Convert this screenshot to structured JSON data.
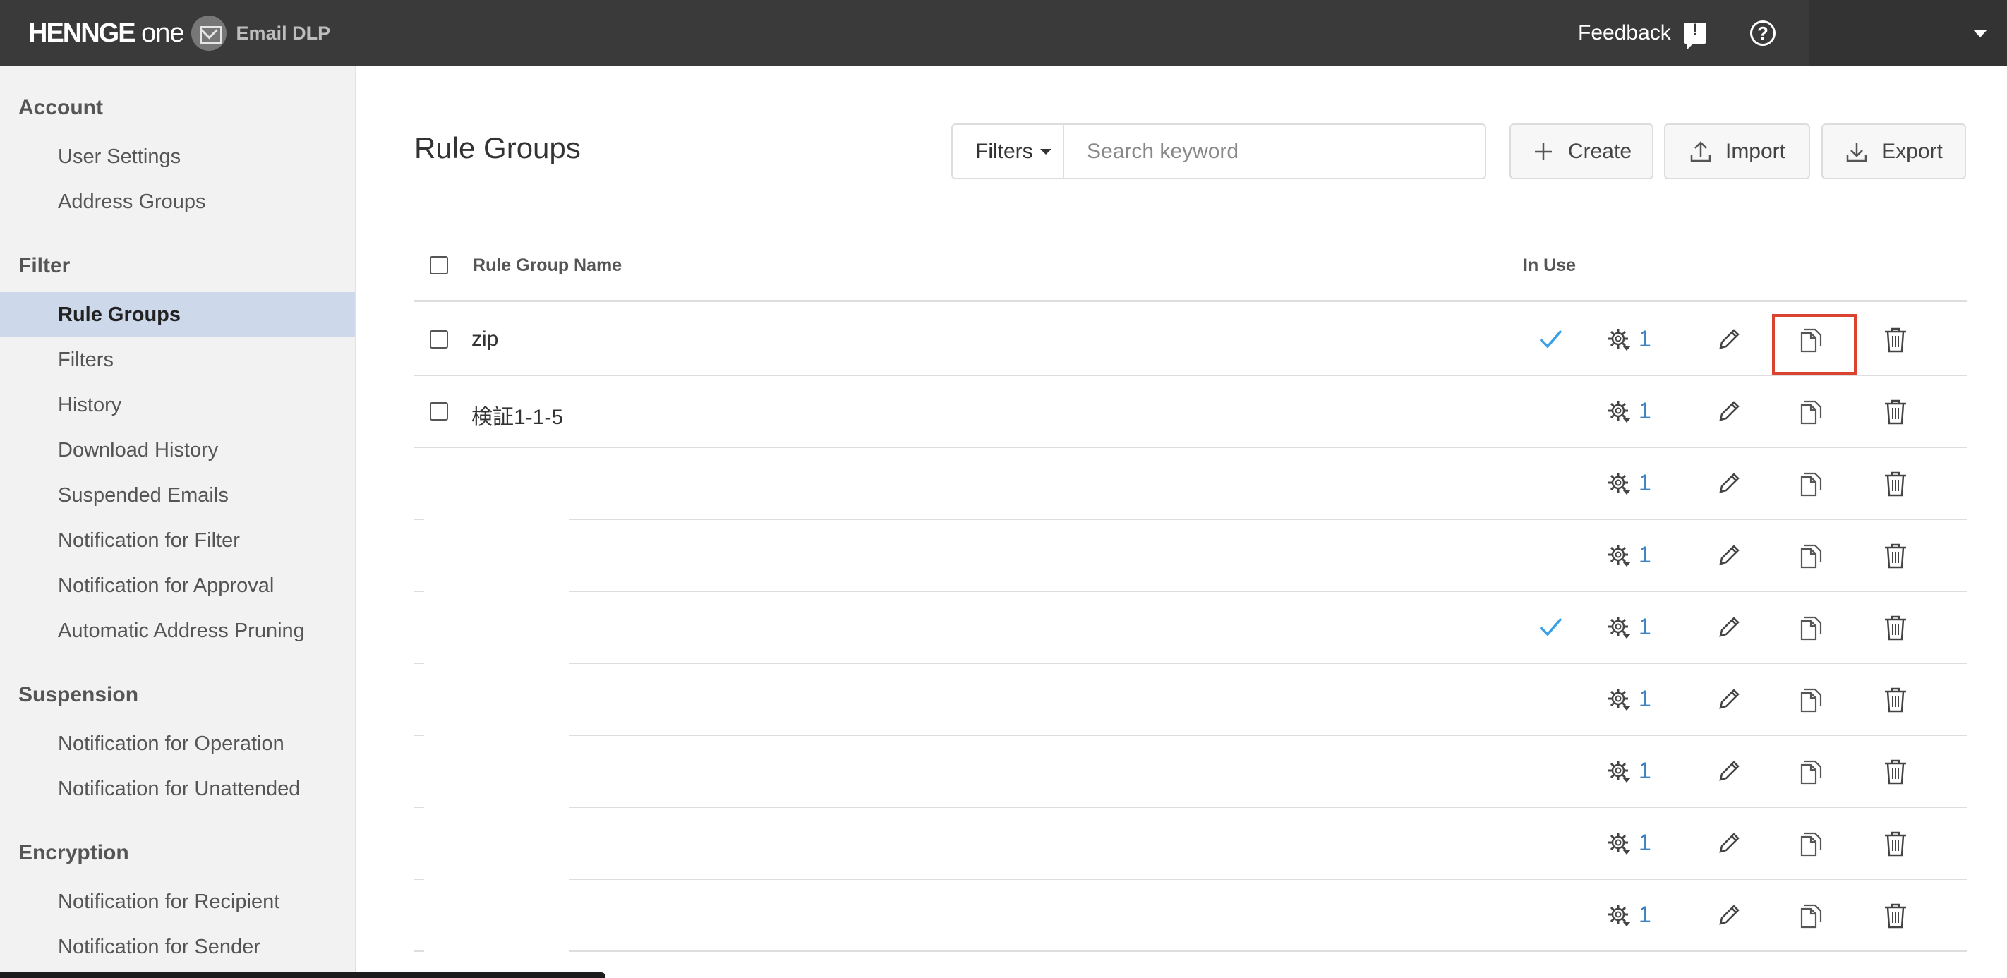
{
  "header": {
    "brand": "HENNGE",
    "brand_suffix": "one",
    "product": "Email DLP",
    "feedback": "Feedback",
    "help_icon": "help-icon",
    "colors": {
      "bar": "#3a3a3a",
      "accent": "#3b82c4",
      "highlight": "#d9432f"
    }
  },
  "sidebar": {
    "sections": [
      {
        "title": "Account",
        "items": [
          "User Settings",
          "Address Groups"
        ]
      },
      {
        "title": "Filter",
        "items": [
          "Rule Groups",
          "Filters",
          "History",
          "Download History",
          "Suspended Emails",
          "Notification for Filter",
          "Notification for Approval",
          "Automatic Address Pruning"
        ]
      },
      {
        "title": "Suspension",
        "items": [
          "Notification for Operation",
          "Notification for Unattended"
        ]
      },
      {
        "title": "Encryption",
        "items": [
          "Notification for Recipient",
          "Notification for Sender"
        ]
      }
    ],
    "active": "Rule Groups"
  },
  "main": {
    "title": "Rule Groups",
    "filters_label": "Filters",
    "search_placeholder": "Search keyword",
    "create_label": "Create",
    "import_label": "Import",
    "export_label": "Export"
  },
  "table": {
    "columns": {
      "name": "Rule Group Name",
      "in_use": "In Use"
    },
    "rows": [
      {
        "name": "zip",
        "in_use": true,
        "count": "1",
        "checkbox": true,
        "copy_highlighted": true
      },
      {
        "name": "検証1-1-5",
        "in_use": false,
        "count": "1",
        "checkbox": true
      },
      {
        "name": "",
        "in_use": false,
        "count": "1",
        "checkbox": false
      },
      {
        "name": "",
        "in_use": false,
        "count": "1",
        "checkbox": false
      },
      {
        "name": "",
        "in_use": true,
        "count": "1",
        "checkbox": false
      },
      {
        "name": "",
        "in_use": false,
        "count": "1",
        "checkbox": false
      },
      {
        "name": "",
        "in_use": false,
        "count": "1",
        "checkbox": false
      },
      {
        "name": "",
        "in_use": false,
        "count": "1",
        "checkbox": false
      },
      {
        "name": "",
        "in_use": false,
        "count": "1",
        "checkbox": false
      }
    ]
  }
}
